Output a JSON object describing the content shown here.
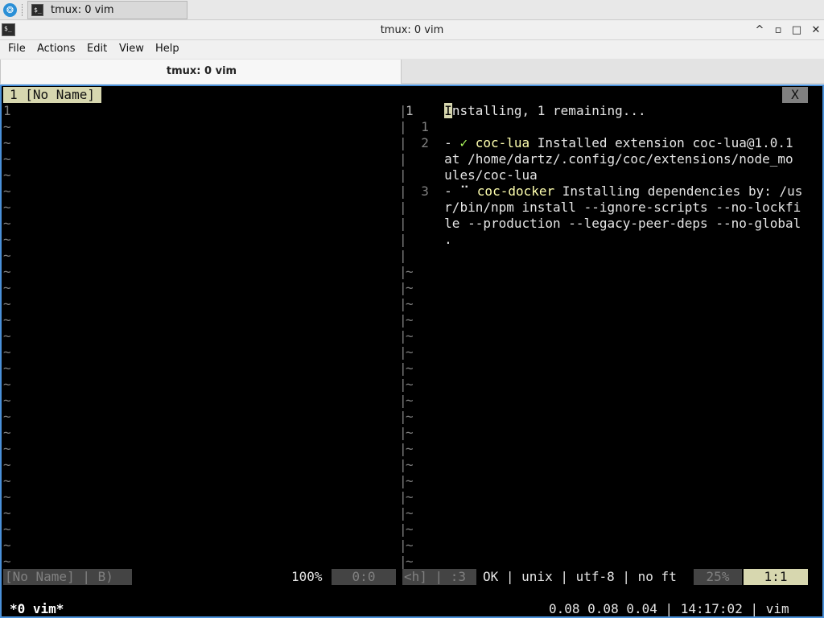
{
  "taskbar": {
    "launcher_glyph": "❂",
    "task_title": "tmux: 0 vim",
    "task_icon_glyph": "$_"
  },
  "window": {
    "title": "tmux: 0 vim",
    "icon_glyph": "$_",
    "buttons": {
      "minimize": "^",
      "restore": "▫",
      "maximize": "□",
      "close": "✕"
    }
  },
  "menu": [
    "File",
    "Actions",
    "Edit",
    "View",
    "Help"
  ],
  "tab": {
    "label": "tmux: 0 vim"
  },
  "vim": {
    "tabline": {
      "label": "1 [No Name]",
      "close": "X"
    },
    "left": {
      "line1": "1",
      "tilde_count": 28
    },
    "right": {
      "lines": [
        {
          "num": "1",
          "cursor": "I",
          "text": "nstalling, 1 remaining..."
        },
        {
          "num": "1",
          "text": ""
        },
        {
          "num": "2",
          "prefix": "- ",
          "mark": "✓",
          "name": "coc-lua",
          "text": " Installed extension coc-lua@1.0.1"
        },
        {
          "num": "",
          "text": "at /home/dartz/.config/coc/extensions/node_mo"
        },
        {
          "num": "",
          "text": "ules/coc-lua"
        },
        {
          "num": "3",
          "prefix": "- ",
          "mark": "⠉",
          "name": "coc-docker",
          "text": " Installing dependencies by: /us"
        },
        {
          "num": "",
          "text": "r/bin/npm install --ignore-scripts --no-lockfi"
        },
        {
          "num": "",
          "text": "le --production --legacy-peer-deps --no-global"
        },
        {
          "num": "",
          "text": "."
        }
      ],
      "tilde_count": 19
    },
    "statusline": {
      "left_name": "[No Name] | B)",
      "left_percent": "100%",
      "left_pos": "0:0",
      "mode_info": "<h] | :3",
      "encoding": "OK | unix | utf-8 | no ft",
      "right_percent": "25%",
      "right_pos": "1:1"
    }
  },
  "tmux": {
    "window": "*0 vim*",
    "right": "0.08 0.08 0.04 | 14:17:02 | vim"
  },
  "colors": {
    "terminal_bg": "#000000",
    "active_border": "#4a90d9",
    "tab_highlight": "#d7d7af",
    "plugin_name": "#ffffaf",
    "check_mark": "#afff5f"
  }
}
